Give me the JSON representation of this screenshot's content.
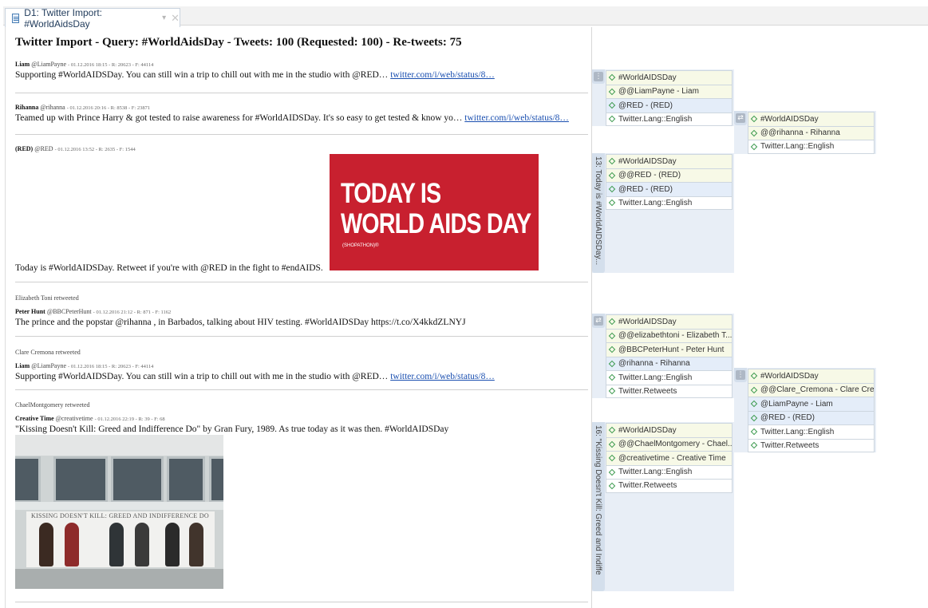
{
  "tab": {
    "title": "D1: Twitter Import: #WorldAidsDay",
    "chevron": "▾",
    "close": "✕"
  },
  "document": {
    "title": "Twitter Import - Query: #WorldAidsDay - Tweets: 100 (Requested: 100) - Re-tweets: 75",
    "tweets": [
      {
        "author": "Liam",
        "handle": "@LiamPayne",
        "meta": "- 01.12.2016 18:15 - R: 20623 - F: 44114",
        "text": "Supporting #WorldAIDSDay. You can still win a trip to chill out with me in the studio with @RED… ",
        "link": "twitter.com/i/web/status/8…"
      },
      {
        "author": "Rihanna",
        "handle": "@rihanna",
        "meta": "- 01.12.2016 20:16 - R: 8538 - F: 23871",
        "text": "Teamed up with Prince Harry & got tested to raise awareness for #WorldAIDSDay. It's so easy to get tested & know yo… ",
        "link": "twitter.com/i/web/status/8…"
      },
      {
        "author": "(RED)",
        "handle": "@RED",
        "meta": "- 01.12.2016 13:52 - R: 2635 - F: 1544",
        "text": "Today is #WorldAIDSDay. Retweet if you're with @RED in the fight to #endAIDS.",
        "image_line1": "TODAY IS",
        "image_line2": "WORLD AIDS DAY",
        "image_logo": "(SHOPATHON)®"
      },
      {
        "retweeted_by": "Elizabeth Toni retweeted",
        "author": "Peter Hunt",
        "handle": "@BBCPeterHunt",
        "meta": "- 01.12.2016 21:12 - R: 871 - F: 1162",
        "text": "The prince and the popstar @rihanna , in Barbados, talking about HIV testing. #WorldAIDSDay https://t.co/X4kkdZLNYJ"
      },
      {
        "retweeted_by": "Clare Cremona retweeted",
        "author": "Liam",
        "handle": "@LiamPayne",
        "meta": "- 01.12.2016 18:15 - R: 20623 - F: 44114",
        "text": "Supporting #WorldAIDSDay. You can still win a trip to chill out with me in the studio with @RED… ",
        "link": "twitter.com/i/web/status/8…"
      },
      {
        "retweeted_by": "ChaelMontgomery retweeted",
        "author": "Creative Time",
        "handle": "@creativetime",
        "meta": "- 01.12.2016 22:19 - R: 39 - F: 68",
        "text": "\"Kissing Doesn't Kill: Greed and Indifference Do\" by Gran Fury, 1989. As true today as it was then. #WorldAIDSDay",
        "image_caption": "KISSING DOESN'T KILL: GREED AND INDIFFERENCE DO"
      }
    ]
  },
  "codes_pane": {
    "groups": [
      {
        "handle_icon": "⋮",
        "rows": [
          {
            "label": "#WorldAIDSDay",
            "tone": "y"
          },
          {
            "label": "@@LiamPayne - Liam",
            "tone": "y"
          },
          {
            "label": "@RED - (RED)",
            "tone": "b"
          },
          {
            "label": "Twitter.Lang::English",
            "tone": "w"
          }
        ]
      },
      {
        "handle_icon": "⇄",
        "rows": [
          {
            "label": "#WorldAIDSDay",
            "tone": "y"
          },
          {
            "label": "@@rihanna - Rihanna",
            "tone": "y"
          },
          {
            "label": "Twitter.Lang::English",
            "tone": "w"
          }
        ]
      },
      {
        "vertical_label": "13: Today is #WorldAIDSDay...",
        "rows": [
          {
            "label": "#WorldAIDSDay",
            "tone": "y"
          },
          {
            "label": "@@RED - (RED)",
            "tone": "y"
          },
          {
            "label": "@RED - (RED)",
            "tone": "b"
          },
          {
            "label": "Twitter.Lang::English",
            "tone": "w"
          }
        ]
      },
      {
        "handle_icon": "⇄",
        "rows": [
          {
            "label": "#WorldAIDSDay",
            "tone": "y"
          },
          {
            "label": "@@elizabethtoni - Elizabeth T...",
            "tone": "y"
          },
          {
            "label": "@BBCPeterHunt - Peter Hunt",
            "tone": "y"
          },
          {
            "label": "@rihanna - Rihanna",
            "tone": "b"
          },
          {
            "label": "Twitter.Lang::English",
            "tone": "w"
          },
          {
            "label": "Twitter.Retweets",
            "tone": "w"
          }
        ]
      },
      {
        "handle_icon": "⋮",
        "rows": [
          {
            "label": "#WorldAIDSDay",
            "tone": "y"
          },
          {
            "label": "@@Clare_Cremona - Clare Cre...",
            "tone": "y"
          },
          {
            "label": "@LiamPayne - Liam",
            "tone": "b"
          },
          {
            "label": "@RED - (RED)",
            "tone": "b"
          },
          {
            "label": "Twitter.Lang::English",
            "tone": "w"
          },
          {
            "label": "Twitter.Retweets",
            "tone": "w"
          }
        ]
      },
      {
        "vertical_label": "16: \"Kissing Doesn't Kill: Greed and Indiffe",
        "rows": [
          {
            "label": "#WorldAIDSDay",
            "tone": "y"
          },
          {
            "label": "@@ChaelMontgomery - Chael...",
            "tone": "y"
          },
          {
            "label": "@creativetime - Creative Time",
            "tone": "y"
          },
          {
            "label": "Twitter.Lang::English",
            "tone": "w"
          },
          {
            "label": "Twitter.Retweets",
            "tone": "w"
          }
        ]
      }
    ]
  }
}
